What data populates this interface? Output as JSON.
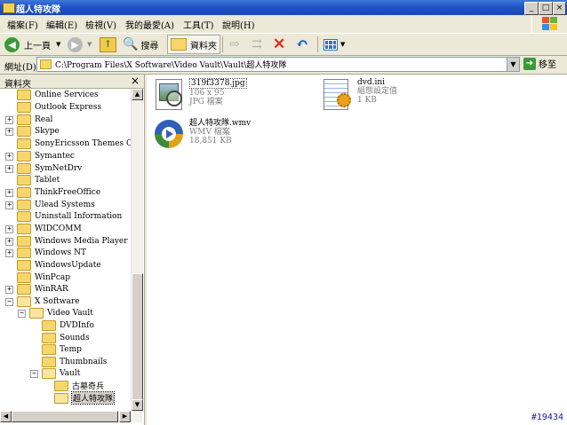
{
  "window": {
    "title": "超人特攻隊"
  },
  "menu": [
    "檔案(F)",
    "編輯(E)",
    "檢視(V)",
    "我的最愛(A)",
    "工具(T)",
    "說明(H)"
  ],
  "toolbar": {
    "back_label": "上一頁",
    "search_label": "搜尋",
    "folders_label": "資料夾"
  },
  "address": {
    "label": "網址(D)",
    "path": "C:\\Program Files\\X Software\\Video Vault\\Vault\\超人特攻隊",
    "go_label": "移至"
  },
  "folder_pane": {
    "title": "資料夾",
    "items": [
      {
        "label": "Online Services",
        "expander": ""
      },
      {
        "label": "Outlook Express",
        "expander": ""
      },
      {
        "label": "Real",
        "expander": "+"
      },
      {
        "label": "Skype",
        "expander": "+"
      },
      {
        "label": "SonyEricsson Themes Creator",
        "expander": ""
      },
      {
        "label": "Symantec",
        "expander": "+"
      },
      {
        "label": "SymNetDrv",
        "expander": "+"
      },
      {
        "label": "Tablet",
        "expander": ""
      },
      {
        "label": "ThinkFreeOffice",
        "expander": "+"
      },
      {
        "label": "Ulead Systems",
        "expander": "+"
      },
      {
        "label": "Uninstall Information",
        "expander": ""
      },
      {
        "label": "WIDCOMM",
        "expander": "+"
      },
      {
        "label": "Windows Media Player",
        "expander": "+"
      },
      {
        "label": "Windows NT",
        "expander": "+"
      },
      {
        "label": "WindowsUpdate",
        "expander": ""
      },
      {
        "label": "WinPcap",
        "expander": ""
      },
      {
        "label": "WinRAR",
        "expander": "+"
      },
      {
        "label": "X Software",
        "expander": "−"
      },
      {
        "label": "Video Vault",
        "expander": "−"
      },
      {
        "label": "DVDInfo",
        "expander": ""
      },
      {
        "label": "Sounds",
        "expander": ""
      },
      {
        "label": "Temp",
        "expander": ""
      },
      {
        "label": "Thumbnails",
        "expander": ""
      },
      {
        "label": "Vault",
        "expander": "−"
      },
      {
        "label": "古墓奇兵",
        "expander": ""
      },
      {
        "label": "超人特攻隊",
        "expander": ""
      }
    ]
  },
  "files": [
    {
      "name": "319f3378.jpg",
      "line2": "106 x 95",
      "line3": "JPG 檔案",
      "icon": "image-file-icon"
    },
    {
      "name": "dvd.ini",
      "line2": "組態設定值",
      "line3": "1 KB",
      "icon": "settings-file-icon"
    },
    {
      "name": "超人特攻隊.wmv",
      "line2": "WMV 檔案",
      "line3": "18,851 KB",
      "icon": "media-file-icon"
    }
  ],
  "watermark": "#19434"
}
